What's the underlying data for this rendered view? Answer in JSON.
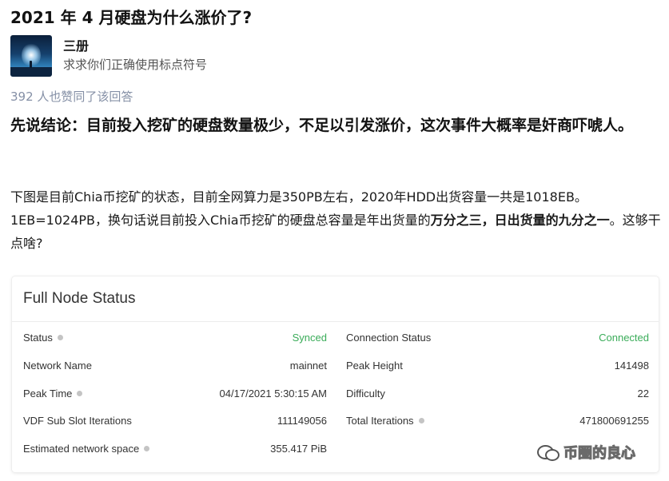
{
  "question": {
    "title": "2021 年 4 月硬盘为什么涨价了?"
  },
  "author": {
    "name": "三册",
    "bio": "求求你们正确使用标点符号"
  },
  "voters": "392 人也赞同了该回答",
  "answer": {
    "lead": "先说结论：目前投入挖矿的硬盘数量极少，不足以引发涨价，这次事件大概率是奸商吓唬人。",
    "para_a": "下图是目前Chia币挖矿的状态，目前全网算力是350PB左右，2020年HDD出货容量一共是1018EB。1EB=1024PB，换句话说目前投入Chia币挖矿的硬盘总容量是年出货量的",
    "para_b": "万分之三",
    "para_c": "，",
    "para_d": "日出货量的九分之一",
    "para_e": "。这够干点啥?"
  },
  "node_status": {
    "title": "Full Node Status",
    "left": [
      {
        "label": "Status",
        "value": "Synced",
        "info": true,
        "green": true
      },
      {
        "label": "Network Name",
        "value": "mainnet",
        "info": false,
        "green": false
      },
      {
        "label": "Peak Time",
        "value": "04/17/2021 5:30:15 AM",
        "info": true,
        "green": false
      },
      {
        "label": "VDF Sub Slot Iterations",
        "value": "111149056",
        "info": false,
        "green": false
      },
      {
        "label": "Estimated network space",
        "value": "355.417 PiB",
        "info": true,
        "green": false
      }
    ],
    "right": [
      {
        "label": "Connection Status",
        "value": "Connected",
        "info": false,
        "green": true
      },
      {
        "label": "Peak Height",
        "value": "141498",
        "info": false,
        "green": false
      },
      {
        "label": "Difficulty",
        "value": "22",
        "info": false,
        "green": false
      },
      {
        "label": "Total Iterations",
        "value": "471800691255",
        "info": true,
        "green": false
      }
    ]
  },
  "watermark": {
    "text": "币圈的良心",
    "icon": "wechat-icon"
  }
}
